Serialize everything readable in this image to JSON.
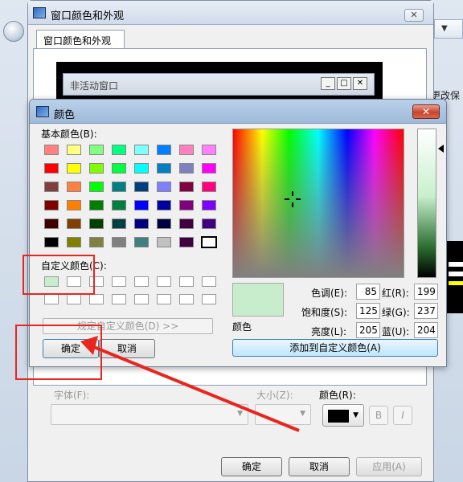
{
  "outer_dialog": {
    "title": "窗口颜色和外观",
    "tab_label": "窗口颜色和外观",
    "preview_inactive_title": "非活动窗口",
    "font_label": "字体(F):",
    "size_label": "大小(Z):",
    "color_label": "颜色(R):",
    "bold_label": "B",
    "italic_label": "I",
    "ok_label": "确定",
    "cancel_label": "取消",
    "apply_label": "应用(A)"
  },
  "background": {
    "right_text": "更改保"
  },
  "color_dialog": {
    "title": "颜色",
    "close_label": "✕",
    "basic_colors_label": "基本颜色(B):",
    "custom_colors_label": "自定义颜色(C):",
    "define_custom_label": "规定自定义颜色(D) >>",
    "ok_label": "确定",
    "cancel_label": "取消",
    "color_solid_label": "颜色",
    "add_custom_label": "添加到自定义颜色(A)",
    "fields": {
      "hue_label": "色调(E):",
      "hue": "85",
      "sat_label": "饱和度(S):",
      "sat": "125",
      "lum_label": "亮度(L):",
      "lum": "205",
      "red_label": "红(R):",
      "red": "199",
      "green_label": "绿(G):",
      "green": "237",
      "blue_label": "蓝(U):",
      "blue": "204"
    },
    "basic_colors": [
      [
        "#ff8080",
        "#ffff80",
        "#80ff80",
        "#00ff80",
        "#80ffff",
        "#0080ff",
        "#ff80c0",
        "#ff80ff"
      ],
      [
        "#ff0000",
        "#ffff00",
        "#80ff00",
        "#00ff40",
        "#00ffff",
        "#0080c0",
        "#8080c0",
        "#ff00ff"
      ],
      [
        "#804040",
        "#ff8040",
        "#00ff00",
        "#008080",
        "#004080",
        "#8080ff",
        "#800040",
        "#ff0080"
      ],
      [
        "#800000",
        "#ff8000",
        "#008000",
        "#008040",
        "#0000ff",
        "#0000a0",
        "#800080",
        "#8000ff"
      ],
      [
        "#400000",
        "#804000",
        "#004000",
        "#004040",
        "#000080",
        "#000040",
        "#400040",
        "#400080"
      ],
      [
        "#000000",
        "#808000",
        "#808040",
        "#808080",
        "#408080",
        "#c0c0c0",
        "#400040",
        "#ffffff"
      ]
    ],
    "selected_basic": [
      5,
      7
    ],
    "custom_colors": [
      "#c7edcc",
      "#ffffff",
      "#ffffff",
      "#ffffff",
      "#ffffff",
      "#ffffff",
      "#ffffff",
      "#ffffff",
      "#ffffff",
      "#ffffff",
      "#ffffff",
      "#ffffff",
      "#ffffff",
      "#ffffff",
      "#ffffff",
      "#ffffff"
    ],
    "current_color": "#c7edcc"
  },
  "annotation_color": "#e8261f"
}
